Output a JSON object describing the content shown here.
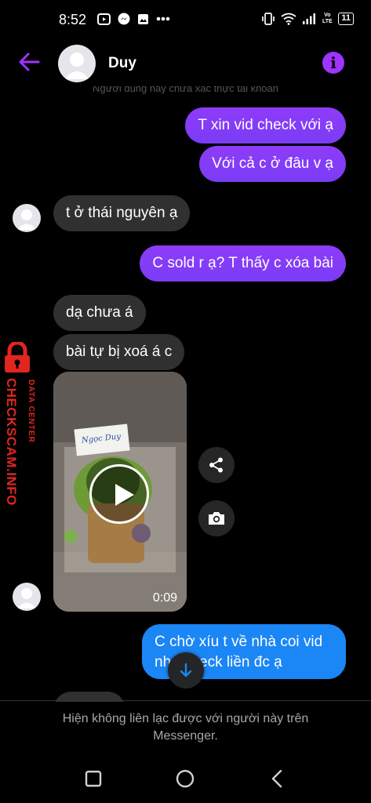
{
  "status_bar": {
    "time": "8:52",
    "left_icons": [
      "youtube-icon",
      "messenger-icon",
      "gallery-icon",
      "more-dots-icon"
    ],
    "right_icons": [
      "vibrate-icon",
      "wifi-icon",
      "signal-icon",
      "volte-icon"
    ],
    "volte_label": "Vo LTE",
    "battery": "11"
  },
  "header": {
    "contact_name": "Duy",
    "info_symbol": "i"
  },
  "chat": {
    "faded_top_text": "Người dùng này chưa xác thực tài khoản",
    "messages": [
      {
        "side": "out",
        "text": "T xin vid check với ạ"
      },
      {
        "side": "out",
        "text": "Với cả c ở đâu v ạ"
      },
      {
        "side": "in",
        "text": "t ở thái nguyên ạ"
      },
      {
        "side": "out",
        "text": "C sold r ạ? T thấy c xóa bài"
      },
      {
        "side": "in",
        "text": "dạ chưa á"
      },
      {
        "side": "in",
        "text": "bài tự bị xoá á c"
      },
      {
        "side": "out",
        "text": "C chờ xíu t về nhà coi vid"
      },
      {
        "side": "out",
        "text": "nhé check liền đc ạ"
      }
    ],
    "video": {
      "duration": "0:09",
      "label_on_bag": "Ngọc Duy"
    }
  },
  "footer": {
    "line1": "Hiện không liên lạc được với người này trên",
    "line2": "Messenger."
  },
  "watermark": {
    "line1": "DATA CENTER",
    "line2": "CHECKSCAM.INFO"
  },
  "colors": {
    "accent": "#8a3ffc",
    "incoming_bubble": "#303030",
    "blue_bubble": "#1b86f5",
    "watermark_red": "#e0261e"
  }
}
